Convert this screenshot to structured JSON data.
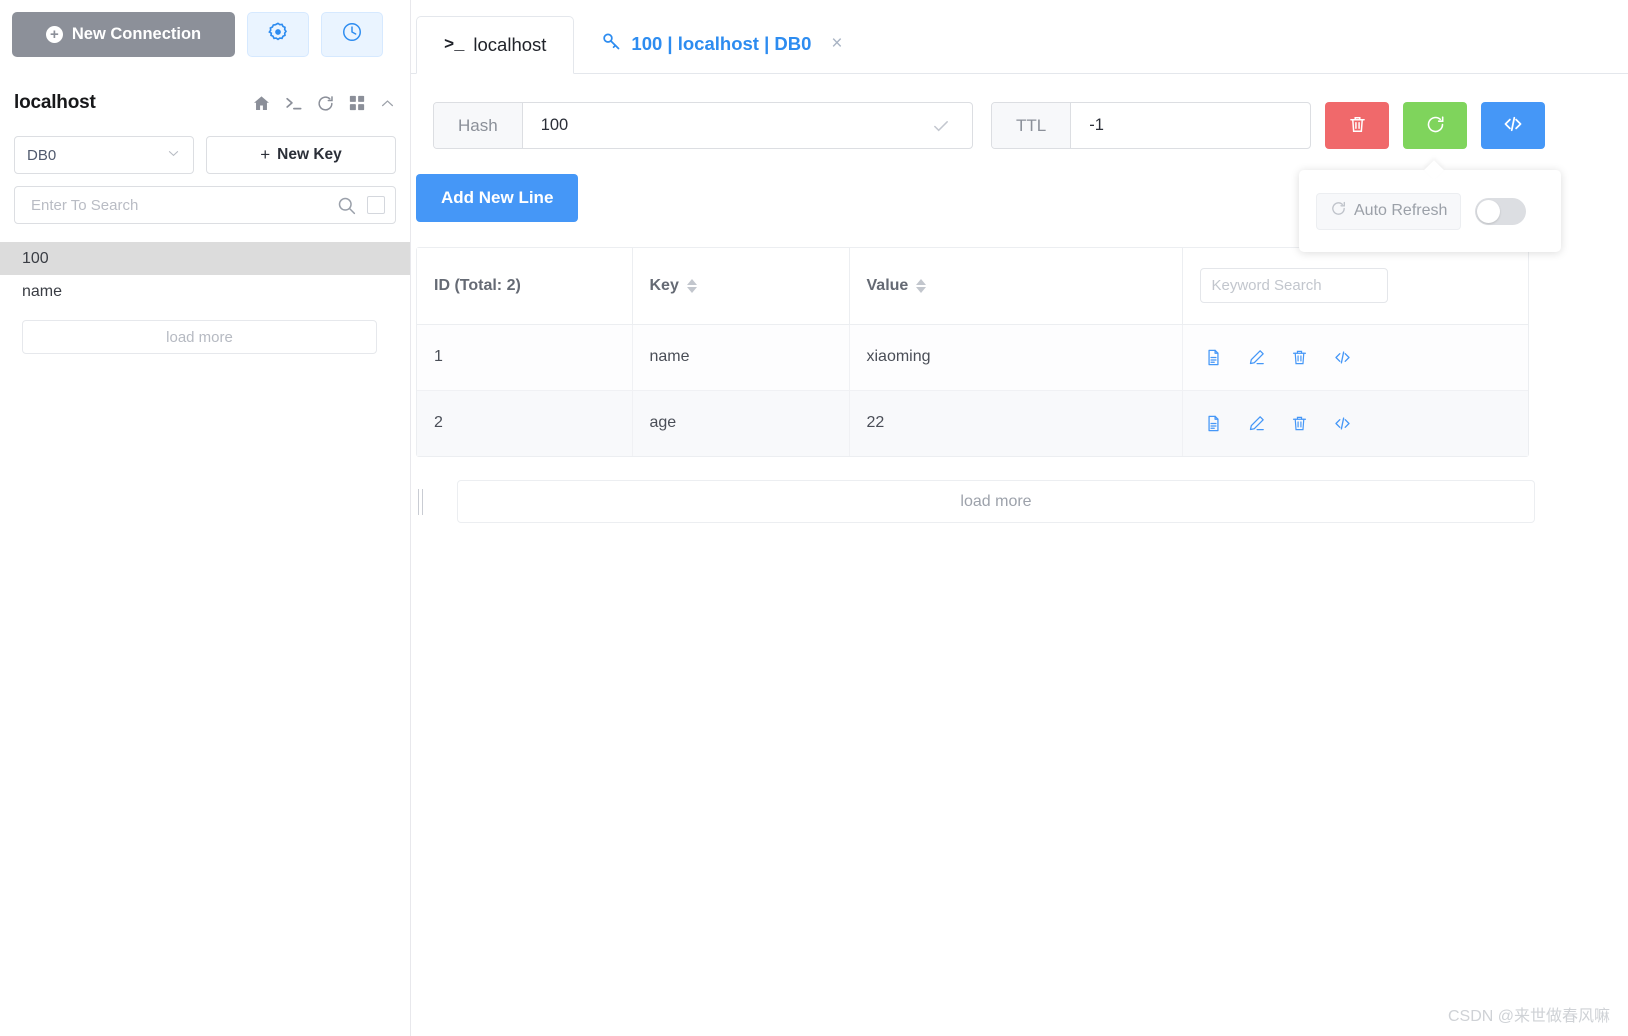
{
  "sidebar": {
    "new_connection_label": "New Connection",
    "host_title": "localhost",
    "header_icons": [
      "home-icon",
      "terminal-icon",
      "refresh-icon",
      "grid-icon",
      "chevron-up-icon"
    ],
    "db_select_value": "DB0",
    "new_key_label": "New Key",
    "search_placeholder": "Enter To Search",
    "search_value": "",
    "keys": [
      {
        "label": "100",
        "selected": true
      },
      {
        "label": "name",
        "selected": false
      }
    ],
    "load_more_label": "load more"
  },
  "tabs": [
    {
      "label": "localhost",
      "icon": "terminal-icon",
      "active": false,
      "closable": false
    },
    {
      "label": "100 | localhost | DB0",
      "icon": "key-icon",
      "active": true,
      "closable": true,
      "close_label": "×"
    }
  ],
  "toolbar": {
    "hash_label": "Hash",
    "hash_value": "100",
    "ttl_label": "TTL",
    "ttl_value": "-1",
    "delete_icon": "trash-icon",
    "refresh_icon": "refresh-icon",
    "code_icon": "code-icon",
    "confirm_icon": "check-icon",
    "clear_icon": "close-icon"
  },
  "popover": {
    "auto_refresh_label": "Auto Refresh",
    "auto_refresh_icon": "refresh-icon",
    "toggle_on": false
  },
  "content": {
    "add_new_line_label": "Add New Line",
    "keyword_search_placeholder": "Keyword Search",
    "keyword_search_value": "",
    "load_more_label": "load more"
  },
  "table": {
    "columns": [
      {
        "header": "ID (Total: 2)",
        "sortable": false
      },
      {
        "header": "Key",
        "sortable": true
      },
      {
        "header": "Value",
        "sortable": true
      },
      {
        "header": "",
        "sortable": false
      }
    ],
    "rows": [
      {
        "id": "1",
        "key": "name",
        "value": "xiaoming"
      },
      {
        "id": "2",
        "key": "age",
        "value": "22"
      }
    ],
    "row_action_icons": [
      "detail-icon",
      "edit-icon",
      "delete-icon",
      "code-icon"
    ]
  },
  "watermark": {
    "text": "CSDN @来世做春风嘛"
  },
  "colors": {
    "primary_blue": "#4597f7",
    "link_blue": "#2d8cf0",
    "danger_red": "#f0696b",
    "success_green": "#7fd45c",
    "grey_button": "#8c9099"
  }
}
